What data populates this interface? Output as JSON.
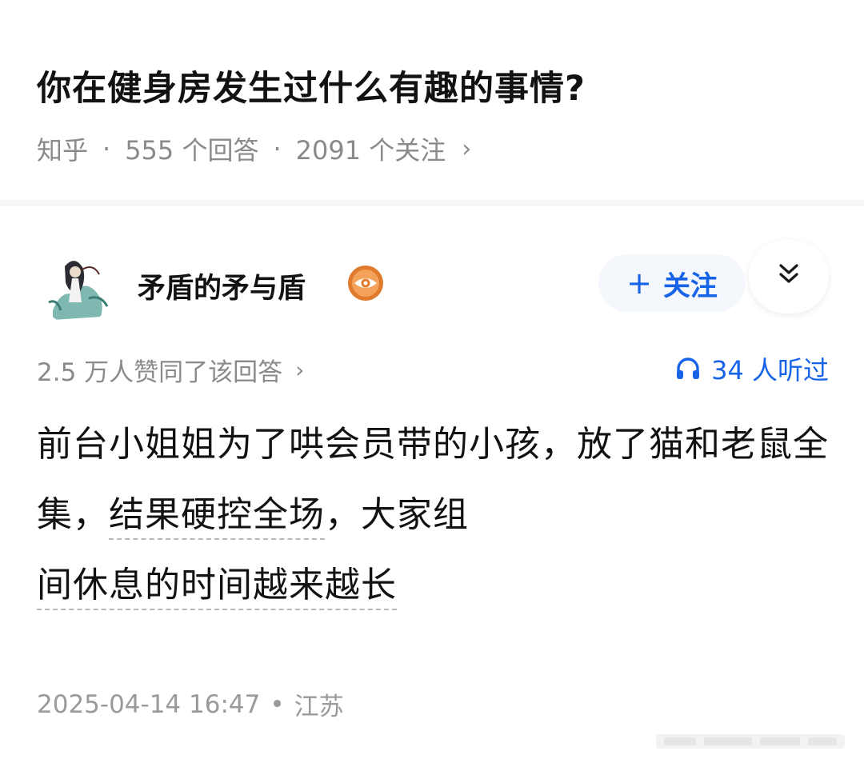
{
  "question": {
    "title": "你在健身房发生过什么有趣的事情?",
    "source": "知乎",
    "answers_count": "555 个回答",
    "followers_count": "2091 个关注",
    "separator": "·",
    "chevron": "›"
  },
  "author": {
    "name": "矛盾的矛与盾",
    "follow_plus": "+",
    "follow_label": "关注"
  },
  "answer": {
    "likes": "2.5 万人赞同了该回答",
    "listens": "34 人听过",
    "text_part1": "前台小姐姐为了哄会员带的小孩，放了猫和老鼠全集，",
    "text_link": "结果硬控全场",
    "text_part2": "，大家组",
    "text_link2": "间休息的时间越来越长",
    "date": "2025-04-14 16:47",
    "location": "江苏",
    "footer_separator": "•"
  },
  "colors": {
    "accent": "#1763e8",
    "meta_gray": "#8a8a8a",
    "badge_orange": "#e07a2c"
  },
  "icons": {
    "badge": "eye-badge-icon",
    "more": "double-chevron-down-icon",
    "listen": "headphones-icon"
  }
}
